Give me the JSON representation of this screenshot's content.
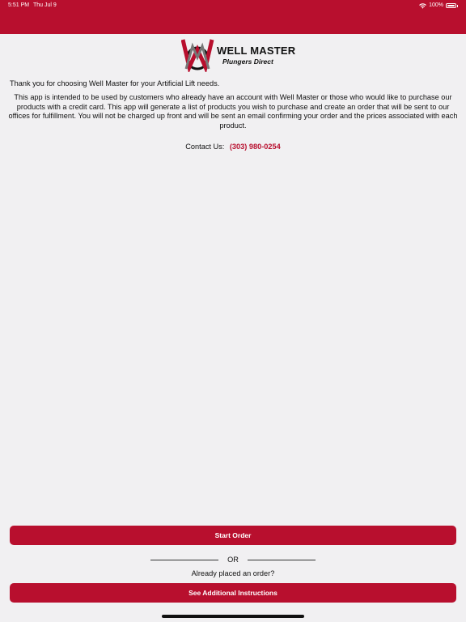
{
  "status_bar": {
    "time": "5:51 PM",
    "date": "Thu Jul 9",
    "battery": "100%",
    "wifi_icon": "wifi-icon",
    "battery_icon": "battery-icon"
  },
  "colors": {
    "brand_red": "#b80f2e",
    "background": "#f1f0f2"
  },
  "logo": {
    "brand": "WELL MASTER",
    "subtitle": "Plungers Direct"
  },
  "content": {
    "intro": "Thank you for choosing Well Master for your Artificial Lift needs.",
    "body": "This app is intended to be used by customers who already have an account with Well Master or those who would like to purchase our products with a credit card.  This app will generate a list of products you wish to purchase and create an order that will be sent to our offices for fulfillment.  You will not be charged up front and will be sent an email confirming your order and the prices associated with each product.",
    "contact_label": "Contact Us:",
    "contact_phone": "(303) 980-0254"
  },
  "actions": {
    "start_order": "Start Order",
    "or": "OR",
    "already_placed": "Already placed an order?",
    "see_instructions": "See Additional Instructions"
  }
}
